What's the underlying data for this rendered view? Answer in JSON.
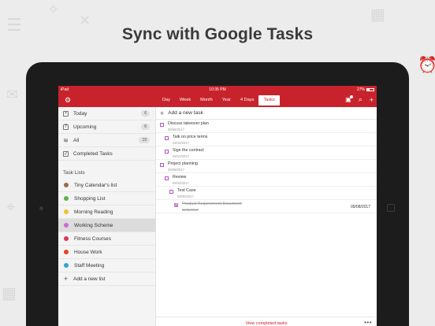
{
  "headline": "Sync with Google Tasks",
  "status_bar": {
    "carrier": "iPad",
    "time": "10:35 PM",
    "battery": "27%"
  },
  "toolbar": {
    "tabs": [
      "Day",
      "Week",
      "Month",
      "Year",
      "4 Days",
      "Tasks"
    ],
    "active_tab": "Tasks"
  },
  "sidebar": {
    "items": [
      {
        "label": "Today",
        "count": "6",
        "icon": "calendar-icon"
      },
      {
        "label": "Upcoming",
        "count": "6",
        "icon": "calendar-icon"
      },
      {
        "label": "All",
        "count": "19",
        "icon": "stack-icon"
      },
      {
        "label": "Completed Tasks",
        "count": "",
        "icon": "checkbox-icon"
      }
    ],
    "lists_header": "Task Lists",
    "lists": [
      {
        "label": "Tiny Calendar's list",
        "color": "#9b6b4a"
      },
      {
        "label": "Shopping List",
        "color": "#59b548"
      },
      {
        "label": "Morning Reading",
        "color": "#f2c12e"
      },
      {
        "label": "Working Scheme",
        "color": "#c86fd6"
      },
      {
        "label": "Fitness Courses",
        "color": "#e0355a"
      },
      {
        "label": "House Work",
        "color": "#e5432a"
      },
      {
        "label": "Staff Meeting",
        "color": "#2ba7d6"
      }
    ],
    "add_list_label": "Add a new list"
  },
  "main": {
    "add_task_label": "Add a new task",
    "tasks": [
      {
        "title": "Discuss takeover plan",
        "date": "09/08/2017",
        "level": 0,
        "done": false,
        "due": ""
      },
      {
        "title": "Talk on price terms",
        "date": "09/10/2017",
        "level": 1,
        "done": false,
        "due": ""
      },
      {
        "title": "Sign the contract",
        "date": "09/14/2017",
        "level": 1,
        "done": false,
        "due": ""
      },
      {
        "title": "Project planning",
        "date": "09/09/2017",
        "level": 0,
        "done": false,
        "due": ""
      },
      {
        "title": "Review",
        "date": "09/20/2017",
        "level": 1,
        "done": false,
        "due": ""
      },
      {
        "title": "Test Case",
        "date": "09/30/2017",
        "level": 2,
        "done": false,
        "due": ""
      },
      {
        "title": "Product Requirement Document",
        "date": "09/08/2017",
        "level": 2,
        "done": true,
        "due": "09/08/2017"
      }
    ],
    "footer_label": "View completed tasks",
    "more_label": "•••"
  }
}
